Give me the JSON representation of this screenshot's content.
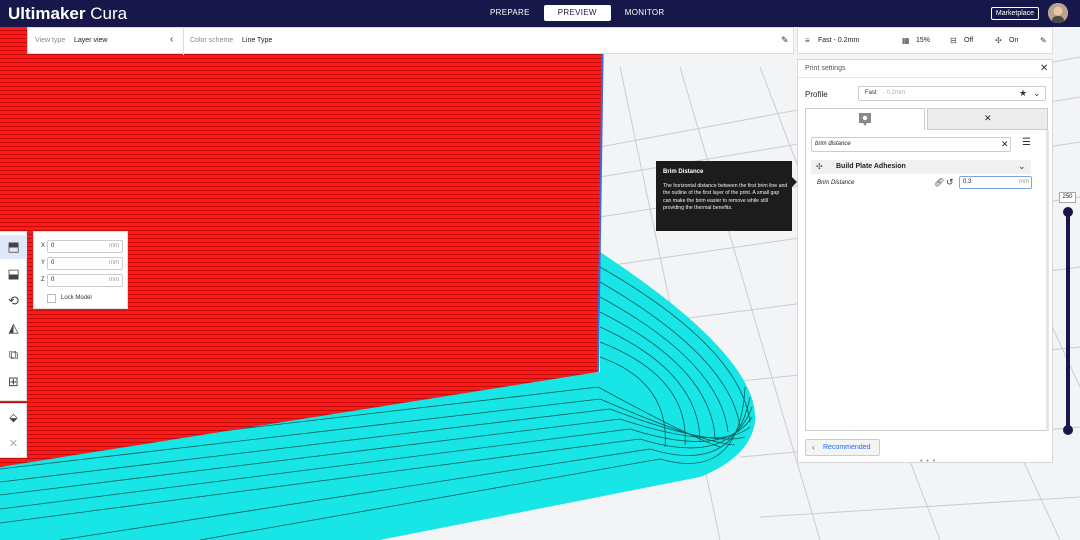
{
  "app": {
    "brand_bold": "Ultimaker",
    "brand_light": "Cura"
  },
  "nav": {
    "tabs": [
      {
        "label": "PREPARE"
      },
      {
        "label": "PREVIEW",
        "active": true
      },
      {
        "label": "MONITOR"
      }
    ]
  },
  "header": {
    "marketplace_label": "Marketplace"
  },
  "viewbar": {
    "view_type_label": "View type",
    "view_type_value": "Layer view",
    "color_scheme_label": "Color scheme",
    "color_scheme_value": "Line Type"
  },
  "summary": {
    "profile": "Fast - 0.2mm",
    "infill": "15%",
    "support": "Off",
    "adhesion": "On"
  },
  "print_settings": {
    "title": "Print settings",
    "profile_label": "Profile",
    "profile_name": "Fast",
    "profile_suffix": "- 0.2mm",
    "search_value": "brim distance",
    "category_label": "Build Plate Adhesion",
    "setting_label": "Brim Distance",
    "setting_value": "0.3",
    "setting_unit": "mm",
    "recommended_label": "Recommended",
    "grip": "• • •"
  },
  "tooltip": {
    "title": "Brim Distance",
    "body": "The horizontal distance between the first brim line and the outline of the first layer of the print. A small gap can make the brim easier to remove while still providing the thermal benefits."
  },
  "move_tool": {
    "rows": [
      {
        "axis": "X",
        "value": "0",
        "unit": "mm"
      },
      {
        "axis": "Y",
        "value": "0",
        "unit": "mm"
      },
      {
        "axis": "Z",
        "value": "0",
        "unit": "mm"
      }
    ],
    "lock_label": "Lock Model"
  },
  "layer_slider": {
    "max_layer": "250"
  },
  "colors": {
    "header": "#18174a",
    "model": "#ff1a1a",
    "brim": "#18e6e6",
    "accent": "#196ef0"
  },
  "icons": {
    "toolbar": [
      "move-icon",
      "scale-icon",
      "rotate-icon",
      "mirror-icon",
      "per-model-settings-icon",
      "support-blocker-icon"
    ],
    "bottom": [
      "marketplace-plugin-icon",
      "close-icon"
    ]
  }
}
